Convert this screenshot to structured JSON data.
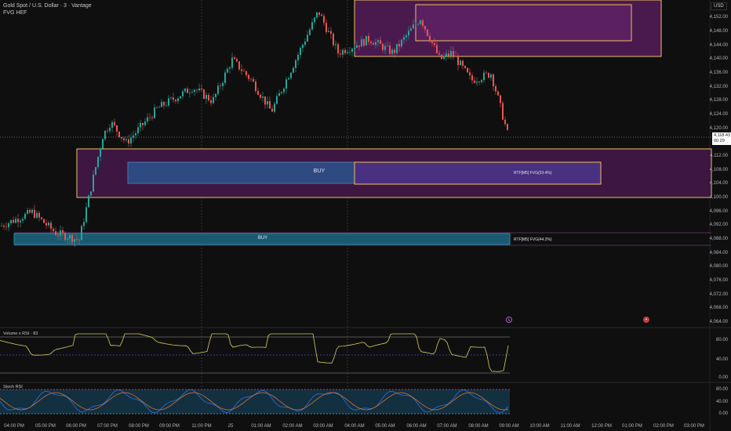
{
  "header": {
    "symbol": "Gold Spot / U.S. Dollar · 3 · Vantage",
    "indicator": "FVG HEF"
  },
  "currency": "USD",
  "current_price": {
    "price": "4,118.43",
    "countdown": "00:29"
  },
  "price_axis": [
    "4,152.00",
    "4,148.00",
    "4,144.00",
    "4,140.00",
    "4,136.00",
    "4,132.00",
    "4,128.00",
    "4,124.00",
    "4,120.00",
    "4,112.00",
    "4,108.00",
    "4,104.00",
    "4,100.00",
    "4,096.00",
    "4,092.00",
    "4,088.00",
    "4,084.00",
    "4,080.00",
    "4,076.00",
    "4,072.00",
    "4,068.00",
    "4,064.00"
  ],
  "time_axis": [
    "04:00 PM",
    "05:00 PM",
    "06:00 PM",
    "07:00 PM",
    "08:00 PM",
    "09:00 PM",
    "11:00 PM",
    "25",
    "01:00 AM",
    "02:00 AM",
    "03:00 AM",
    "04:00 AM",
    "05:00 AM",
    "06:00 AM",
    "07:00 AM",
    "08:00 AM",
    "09:00 AM",
    "10:00 AM",
    "11:00 AM",
    "12:00 PM",
    "01:00 PM",
    "02:00 PM",
    "03:00 PM"
  ],
  "zones": {
    "buy1": "BUY",
    "buy1_label": "RTF[M5] FVG(33.4%)",
    "buy2": "BUY",
    "buy2_label": "RTF[M5] FVG(44.2%)"
  },
  "panels": {
    "vol_rsi": {
      "title": "Volume x RSI · 83",
      "levels": [
        "80.00",
        "40.00",
        "0.00"
      ]
    },
    "stoch": {
      "title": "Stoch RSI",
      "levels": [
        "80.00",
        "40.00",
        "0.00"
      ]
    }
  },
  "colors": {
    "up": "#26a69a",
    "down": "#ef5350",
    "zone": "#4a1a4f",
    "border": "#f0c060",
    "buy": "#3a5a9a"
  },
  "chart_data": {
    "type": "candlestick",
    "timeframe": "3m",
    "ylim": [
      4062,
      4155
    ],
    "waypoints": [
      [
        0,
        4092
      ],
      [
        40,
        4096
      ],
      [
        70,
        4090
      ],
      [
        100,
        4088
      ],
      [
        130,
        4118
      ],
      [
        140,
        4122
      ],
      [
        160,
        4116
      ],
      [
        200,
        4126
      ],
      [
        245,
        4132
      ],
      [
        270,
        4128
      ],
      [
        295,
        4140
      ],
      [
        320,
        4134
      ],
      [
        345,
        4125
      ],
      [
        380,
        4142
      ],
      [
        405,
        4154
      ],
      [
        430,
        4142
      ],
      [
        470,
        4146
      ],
      [
        500,
        4142
      ],
      [
        535,
        4152
      ],
      [
        560,
        4140
      ],
      [
        575,
        4142
      ],
      [
        600,
        4134
      ],
      [
        625,
        4136
      ],
      [
        635,
        4128
      ],
      [
        648,
        4117
      ]
    ]
  }
}
